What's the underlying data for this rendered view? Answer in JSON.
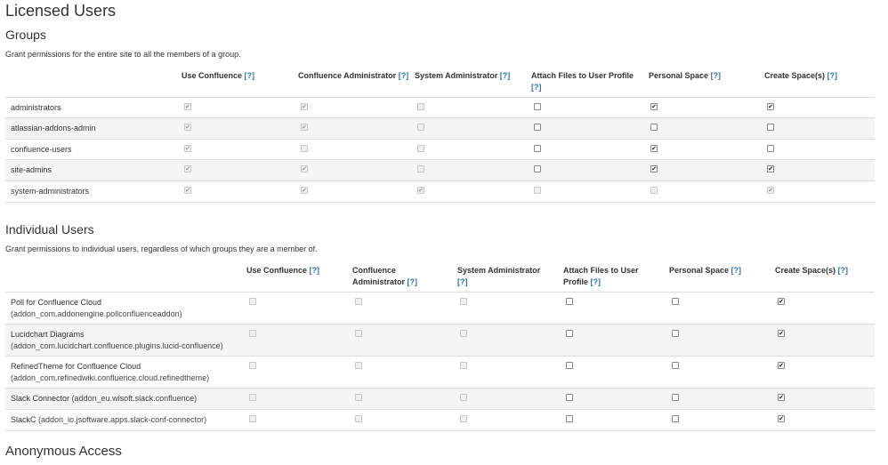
{
  "page": {
    "title": "Licensed Users"
  },
  "groups": {
    "heading": "Groups",
    "description": "Grant permissions for the entire site to all the members of a group.",
    "columns": [
      {
        "label": "Use Confluence",
        "help": "[?]"
      },
      {
        "label": "Confluence Administrator",
        "help": "[?]"
      },
      {
        "label": "System Administrator",
        "help": "[?]"
      },
      {
        "label": "Attach Files to User Profile",
        "help": "[?]"
      },
      {
        "label": "Personal Space",
        "help": "[?]"
      },
      {
        "label": "Create Space(s)",
        "help": "[?]"
      }
    ],
    "rows": [
      {
        "name": "administrators",
        "perms": [
          {
            "checked": true,
            "disabled": true
          },
          {
            "checked": true,
            "disabled": true
          },
          {
            "checked": false,
            "disabled": true
          },
          {
            "checked": false,
            "disabled": false
          },
          {
            "checked": true,
            "disabled": false
          },
          {
            "checked": true,
            "disabled": false
          }
        ]
      },
      {
        "name": "atlassian-addons-admin",
        "perms": [
          {
            "checked": true,
            "disabled": true
          },
          {
            "checked": true,
            "disabled": true
          },
          {
            "checked": false,
            "disabled": true
          },
          {
            "checked": false,
            "disabled": false
          },
          {
            "checked": false,
            "disabled": false
          },
          {
            "checked": false,
            "disabled": false
          }
        ]
      },
      {
        "name": "confluence-users",
        "perms": [
          {
            "checked": true,
            "disabled": true
          },
          {
            "checked": false,
            "disabled": true
          },
          {
            "checked": false,
            "disabled": true
          },
          {
            "checked": false,
            "disabled": false
          },
          {
            "checked": true,
            "disabled": false
          },
          {
            "checked": false,
            "disabled": false
          }
        ]
      },
      {
        "name": "site-admins",
        "perms": [
          {
            "checked": true,
            "disabled": true
          },
          {
            "checked": true,
            "disabled": true
          },
          {
            "checked": false,
            "disabled": true
          },
          {
            "checked": false,
            "disabled": false
          },
          {
            "checked": true,
            "disabled": false
          },
          {
            "checked": true,
            "disabled": false
          }
        ]
      },
      {
        "name": "system-administrators",
        "perms": [
          {
            "checked": true,
            "disabled": true
          },
          {
            "checked": true,
            "disabled": true
          },
          {
            "checked": true,
            "disabled": true
          },
          {
            "checked": false,
            "disabled": true
          },
          {
            "checked": false,
            "disabled": true
          },
          {
            "checked": true,
            "disabled": true
          }
        ]
      }
    ]
  },
  "individual": {
    "heading": "Individual Users",
    "description": "Grant permissions to individual users, regardless of which groups they are a member of.",
    "columns": [
      {
        "label": "Use Confluence",
        "help": "[?]"
      },
      {
        "label": "Confluence Administrator",
        "help": "[?]"
      },
      {
        "label": "System Administrator",
        "help": "[?]"
      },
      {
        "label": "Attach Files to User Profile",
        "help": "[?]"
      },
      {
        "label": "Personal Space",
        "help": "[?]"
      },
      {
        "label": "Create Space(s)",
        "help": "[?]"
      }
    ],
    "rows": [
      {
        "name": "Poll for Confluence Cloud",
        "detail": "(addon_com.addonengine.pollconfluenceaddon)",
        "perms": [
          {
            "checked": false,
            "disabled": true
          },
          {
            "checked": false,
            "disabled": true
          },
          {
            "checked": false,
            "disabled": true
          },
          {
            "checked": false,
            "disabled": false
          },
          {
            "checked": false,
            "disabled": false
          },
          {
            "checked": true,
            "disabled": false
          }
        ]
      },
      {
        "name": "Lucidchart Diagrams",
        "detail": "(addon_com.lucidchart.confluence.plugins.lucid-confluence)",
        "perms": [
          {
            "checked": false,
            "disabled": true
          },
          {
            "checked": false,
            "disabled": true
          },
          {
            "checked": false,
            "disabled": true
          },
          {
            "checked": false,
            "disabled": false
          },
          {
            "checked": false,
            "disabled": false
          },
          {
            "checked": true,
            "disabled": false
          }
        ]
      },
      {
        "name": "RefinedTheme for Confluence Cloud",
        "detail": "(addon_com.refinedwiki.confluence.cloud.refinedtheme)",
        "perms": [
          {
            "checked": false,
            "disabled": true
          },
          {
            "checked": false,
            "disabled": true
          },
          {
            "checked": false,
            "disabled": true
          },
          {
            "checked": false,
            "disabled": false
          },
          {
            "checked": false,
            "disabled": false
          },
          {
            "checked": true,
            "disabled": false
          }
        ]
      },
      {
        "name": "Slack Connector",
        "detail": "(addon_eu.wisoft.slack.confluence)",
        "perms": [
          {
            "checked": false,
            "disabled": true
          },
          {
            "checked": false,
            "disabled": true
          },
          {
            "checked": false,
            "disabled": true
          },
          {
            "checked": false,
            "disabled": false
          },
          {
            "checked": false,
            "disabled": false
          },
          {
            "checked": true,
            "disabled": false
          }
        ]
      },
      {
        "name": "SlackC",
        "detail": "(addon_io.jsoftware.apps.slack-conf-connector)",
        "perms": [
          {
            "checked": false,
            "disabled": true
          },
          {
            "checked": false,
            "disabled": true
          },
          {
            "checked": false,
            "disabled": true
          },
          {
            "checked": false,
            "disabled": false
          },
          {
            "checked": false,
            "disabled": false
          },
          {
            "checked": true,
            "disabled": false
          }
        ]
      }
    ]
  },
  "anonymous": {
    "heading": "Anonymous Access"
  },
  "colors": {
    "help_link": "#3572b0",
    "row_alt": "#f5f5f5",
    "border": "#dddddd"
  }
}
